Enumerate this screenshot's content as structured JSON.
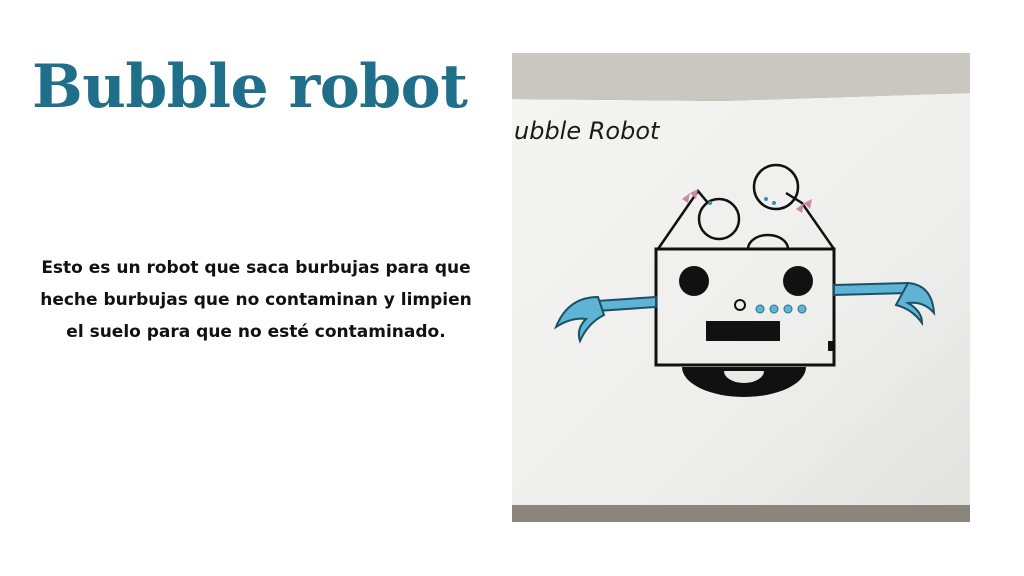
{
  "slide": {
    "title": "Bubble robot",
    "description": "Esto es un robot que saca burbujas para que heche burbujas que no contaminan y limpien el suelo para que no esté contaminado.",
    "title_color": "#1f6f8b"
  },
  "photo": {
    "drawing_title": "ubble Robot",
    "ink_color": "#111111",
    "arm_color": "#5fb4d6",
    "bow_color": "#c98aa8"
  }
}
